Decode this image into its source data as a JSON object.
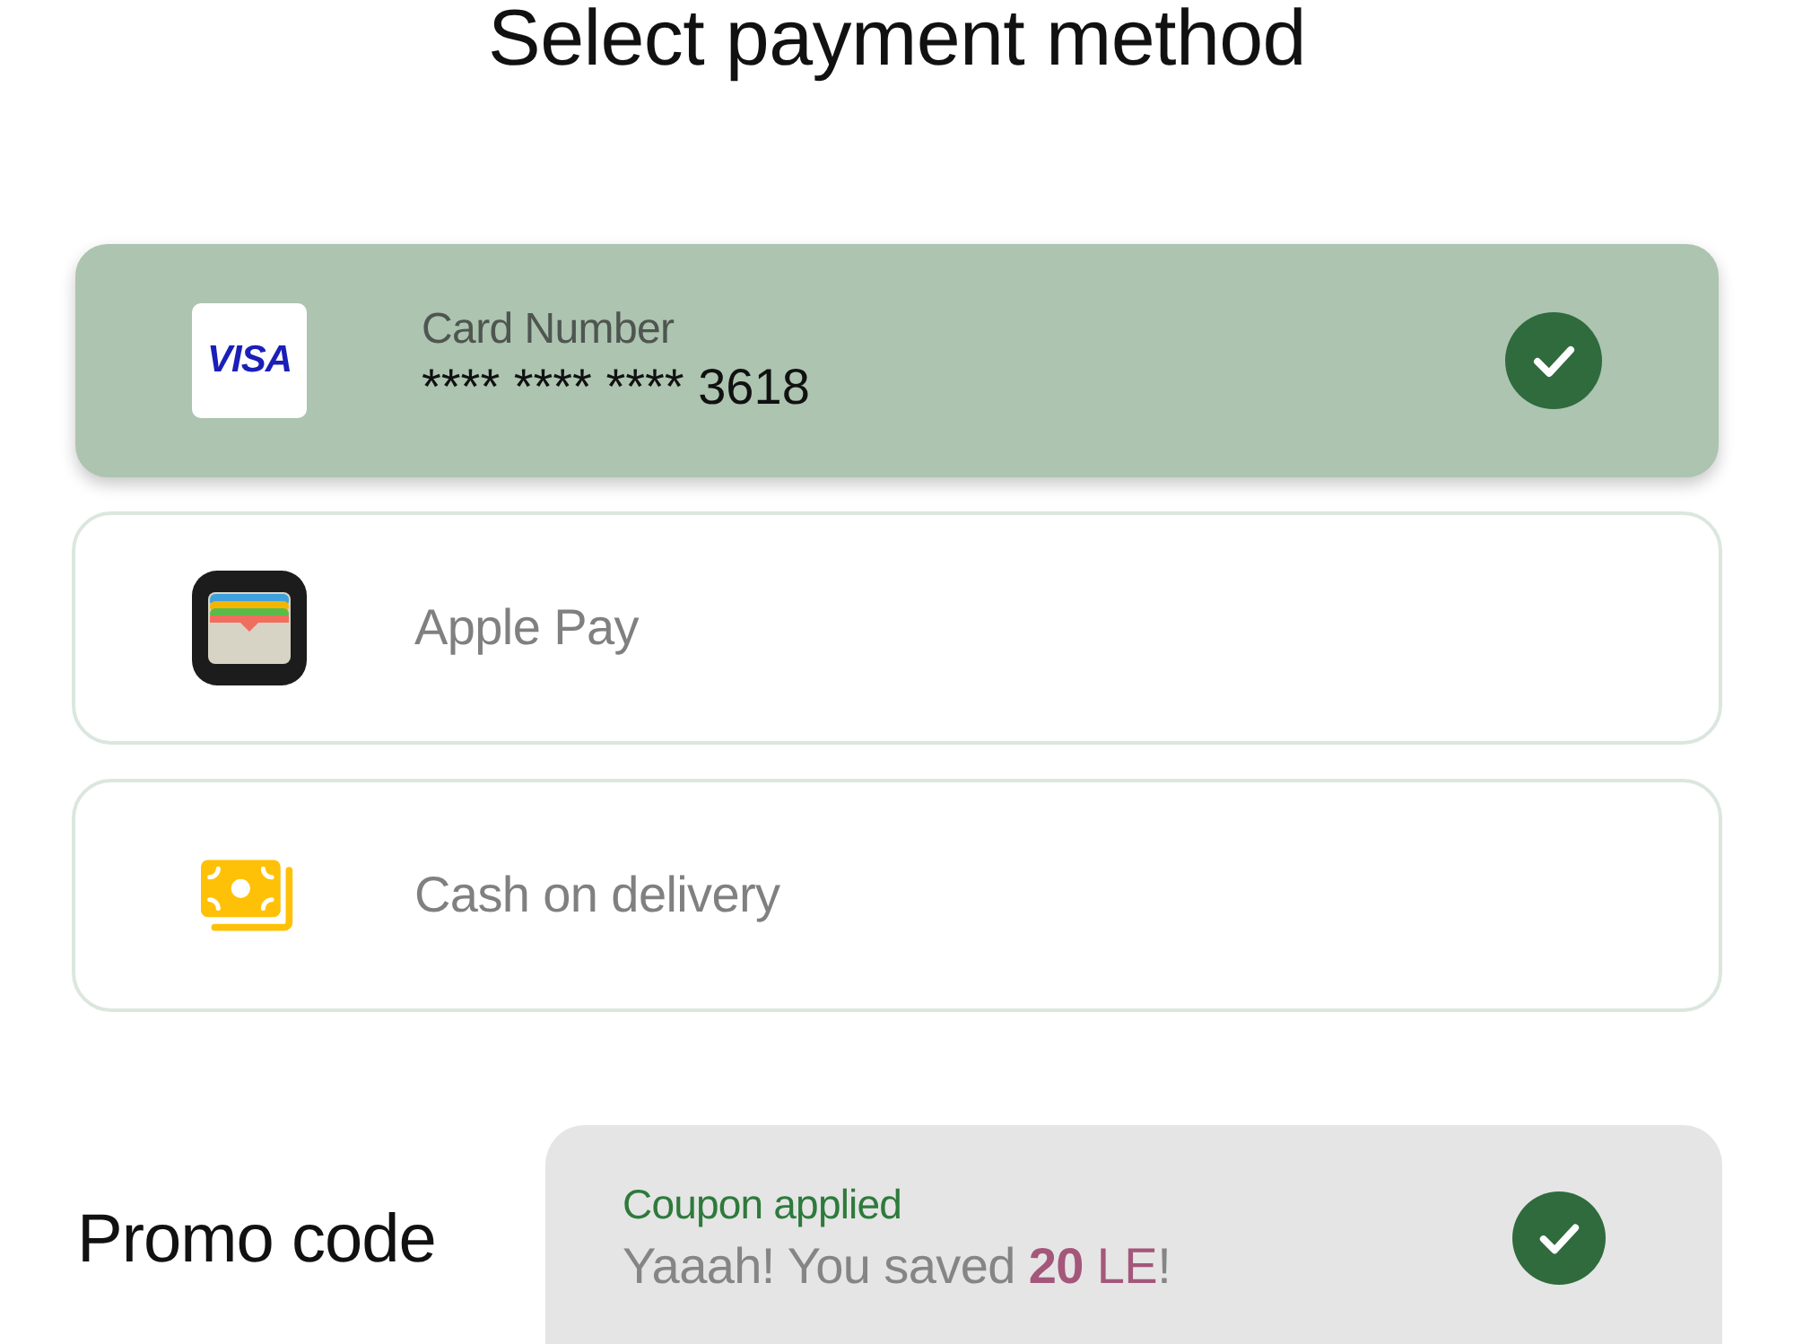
{
  "title": "Select payment method",
  "methods": [
    {
      "kind": "card",
      "brand": "VISA",
      "label": "Card Number",
      "number": "**** **** **** 3618",
      "selected": true
    },
    {
      "kind": "wallet",
      "label": "Apple Pay",
      "selected": false
    },
    {
      "kind": "cash",
      "label": "Cash on delivery",
      "selected": false
    }
  ],
  "promo": {
    "label": "Promo code",
    "coupon": {
      "status": "Coupon applied",
      "applied": true,
      "message": {
        "lead": "Yaaah! You saved",
        "amount": "20",
        "unit": "LE",
        "end": "!"
      }
    }
  }
}
